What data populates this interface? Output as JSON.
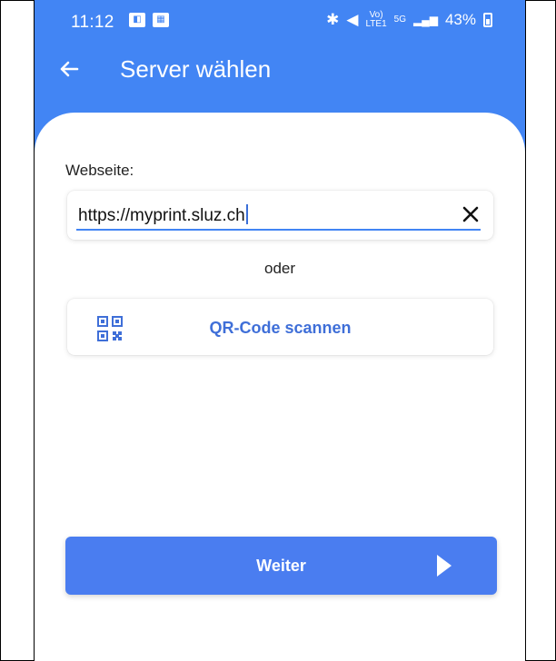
{
  "status_bar": {
    "time": "11:12",
    "battery": "43%",
    "volte": "Vo)",
    "lte": "LTE1",
    "net5g": "5G"
  },
  "appbar": {
    "title": "Server wählen",
    "back_icon": "arrow-left-icon"
  },
  "form": {
    "website_label": "Webseite:",
    "website_value": "https://myprint.sluz.ch",
    "clear_icon": "close-icon",
    "or_text": "oder",
    "qr_icon": "qr-code-icon",
    "qr_label": "QR-Code scannen"
  },
  "actions": {
    "next_label": "Weiter",
    "next_icon": "play-arrow-icon"
  },
  "colors": {
    "primary": "#4285f4",
    "button": "#4a7df0",
    "link": "#3f6fd8"
  }
}
